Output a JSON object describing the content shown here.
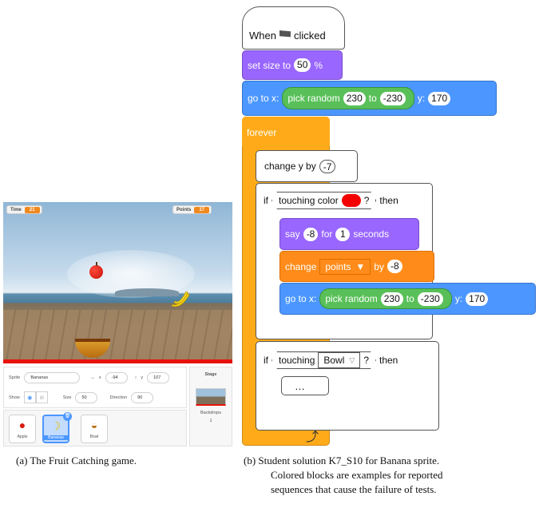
{
  "game": {
    "time_label": "Time",
    "time_value": "21",
    "points_label": "Points",
    "points_value": "17",
    "sprite_label": "Sprite",
    "sprite_name": "Bananas",
    "x_label": "x",
    "x_value": "-94",
    "y_label": "y",
    "y_value": "107",
    "show_label": "Show",
    "size_label": "Size",
    "size_value": "50",
    "direction_label": "Direction",
    "direction_value": "90",
    "stage_label": "Stage",
    "backdrops_label": "Backdrops",
    "backdrops_count": "1",
    "sprites": [
      "Apple",
      "Bananas",
      "Bowl"
    ]
  },
  "code": {
    "when": "When",
    "clicked": "clicked",
    "set_size_to": "set size to",
    "size": "50",
    "percent": "%",
    "go_to_x": "go to x:",
    "pick_random": "pick random",
    "rand_from": "230",
    "to": "to",
    "rand_to": "-230",
    "y": "y:",
    "y_value": "170",
    "forever": "forever",
    "change_y_by": "change y by",
    "dy": "-7",
    "if": "if",
    "touching_color": "touching color",
    "q": "?",
    "then": "then",
    "say": "say",
    "say_value": "-8",
    "for": "for",
    "seconds_value": "1",
    "seconds": "seconds",
    "change": "change",
    "variable": "points",
    "by": "by",
    "change_value": "-8",
    "touching": "touching",
    "bowl": "Bowl",
    "ellipsis": "…"
  },
  "captions": {
    "a": "(a) The Fruit Catching game.",
    "b_line1": "(b) Student solution K7_S10 for Banana sprite.",
    "b_line2": "Colored blocks are examples for reported",
    "b_line3": "sequences that cause the failure of tests."
  },
  "colors": {
    "motion": "#4c97ff",
    "looks": "#9966ff",
    "control": "#ffab19",
    "variables": "#ff8c1a",
    "operators": "#59c059"
  }
}
